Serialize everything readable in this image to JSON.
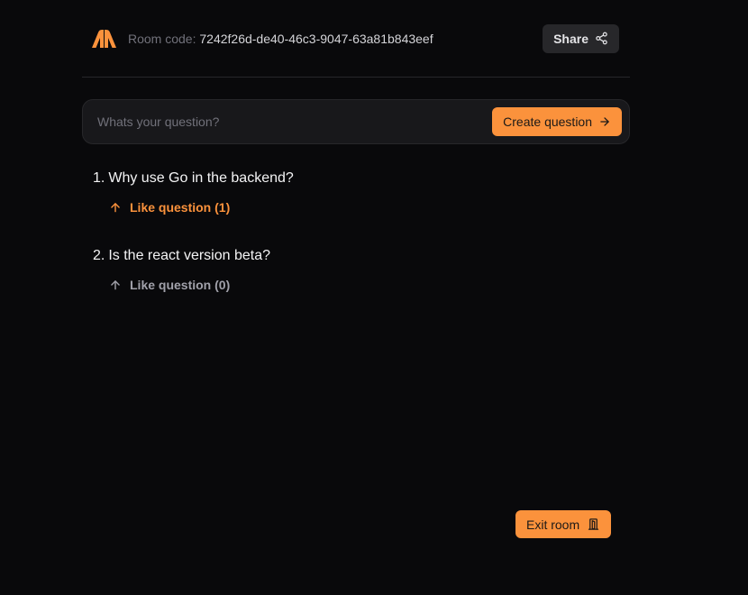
{
  "header": {
    "logo_icon": "app-logo",
    "room_code_label": "Room code:",
    "room_code_value": "7242f26d-de40-46c3-9047-63a81b843eef",
    "share_label": "Share",
    "share_icon": "share-icon"
  },
  "ask_form": {
    "placeholder": "Whats your question?",
    "value": "",
    "submit_label": "Create question",
    "submit_icon": "arrow-right-icon"
  },
  "questions": [
    {
      "number": "1.",
      "text": "Why use Go in the backend?",
      "like_label": "Like question (1)",
      "liked": true,
      "like_icon": "arrow-up-icon"
    },
    {
      "number": "2.",
      "text": "Is the react version beta?",
      "like_label": "Like question (0)",
      "liked": false,
      "like_icon": "arrow-up-icon"
    }
  ],
  "exit": {
    "label": "Exit room",
    "icon": "door-exit-icon"
  },
  "colors": {
    "background": "#09090b",
    "accent": "#fb923c",
    "surface": "#18181b",
    "muted": "#71717a"
  }
}
